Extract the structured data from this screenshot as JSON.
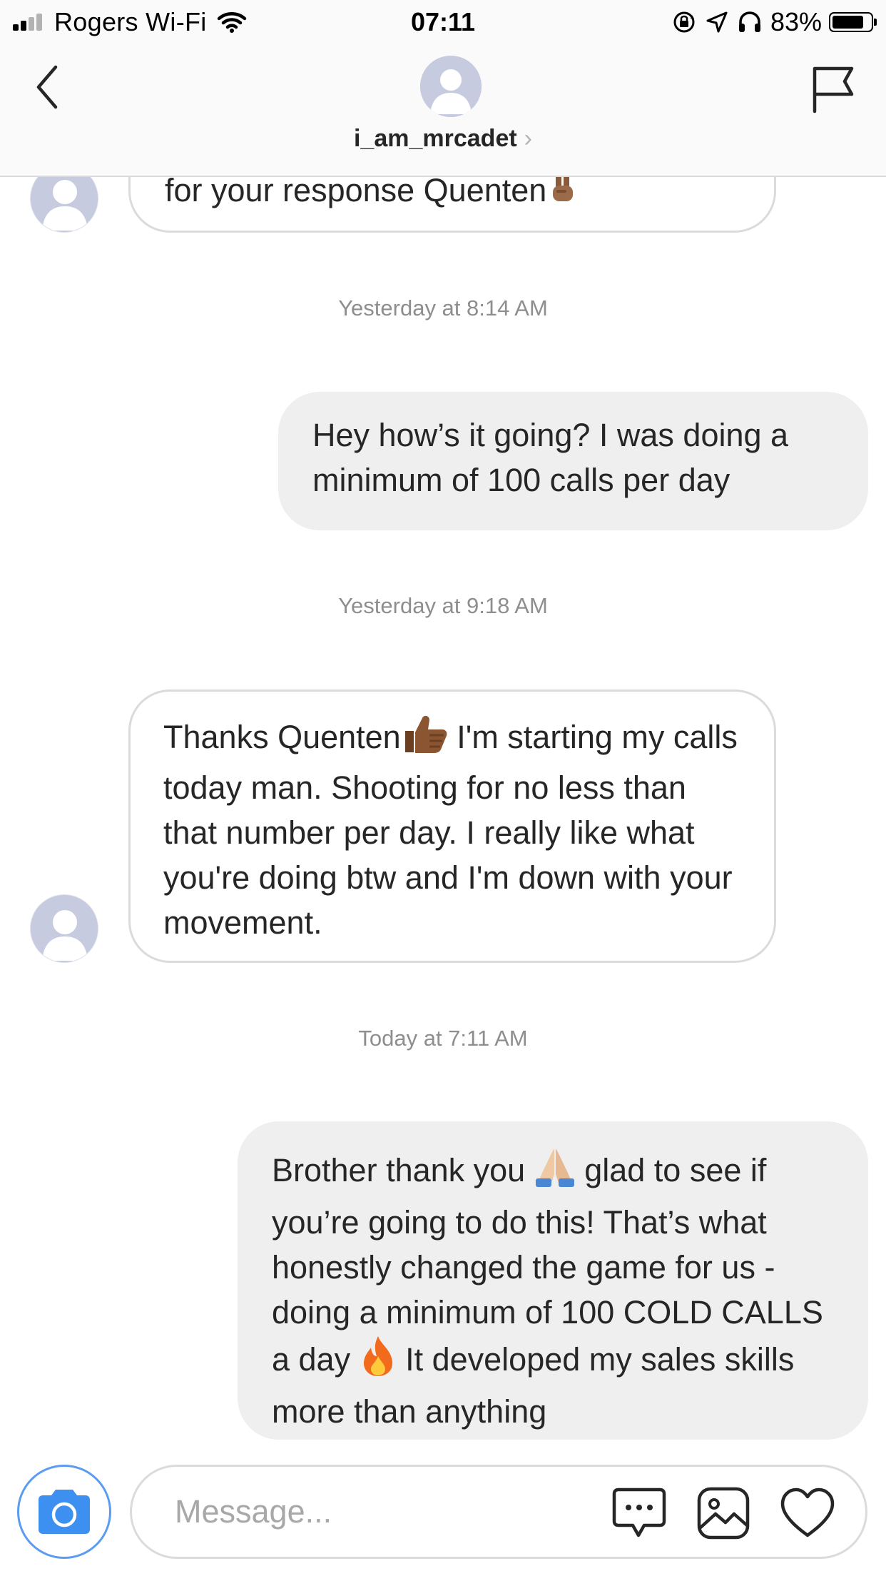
{
  "status_bar": {
    "carrier": "Rogers Wi-Fi",
    "time": "07:11",
    "battery_percent": "83%",
    "battery_level": 0.83,
    "icons": [
      "signal-icon",
      "wifi-icon",
      "orientation-lock-icon",
      "location-arrow-icon",
      "headphones-icon",
      "battery-icon"
    ]
  },
  "header": {
    "username": "i_am_mrcadet",
    "chevron": "›",
    "icons": [
      "back-chevron-icon",
      "flag-icon",
      "avatar-placeholder-icon"
    ]
  },
  "messages": [
    {
      "type": "incoming",
      "text_before": "for your response Quenten",
      "emoji": "✌️",
      "partial": true
    },
    {
      "type": "timestamp",
      "text": "Yesterday at 8:14 AM"
    },
    {
      "type": "outgoing",
      "text": "Hey how’s it going? I was doing a minimum of 100 calls per day"
    },
    {
      "type": "timestamp",
      "text": "Yesterday at 9:18 AM"
    },
    {
      "type": "incoming",
      "text_before": "Thanks Quenten",
      "emoji": "👍🏾",
      "text_after": " I'm starting my calls today man. Shooting for no less than that number per day. I really like what you're doing btw and I'm down with your movement."
    },
    {
      "type": "timestamp",
      "text": "Today at 7:11 AM"
    },
    {
      "type": "outgoing",
      "text_before": "Brother thank you ",
      "emoji": "🙏🏼",
      "text_middle": " glad to see if you’re going to do this! That’s what honestly changed the game for us - doing a minimum of 100 COLD CALLS a day ",
      "emoji2": "🔥",
      "text_after": " It developed my sales skills more than anything"
    }
  ],
  "composer": {
    "placeholder": "Message...",
    "value": "",
    "icons": [
      "camera-icon",
      "chat-bubble-icon",
      "gallery-icon",
      "heart-icon"
    ]
  },
  "colors": {
    "accent_blue": "#3d8ff0",
    "bubble_out_bg": "#efefef",
    "bubble_in_border": "#dbdbdb",
    "timestamp_gray": "#8e8e8e",
    "avatar_bg": "#c7cbe0"
  }
}
